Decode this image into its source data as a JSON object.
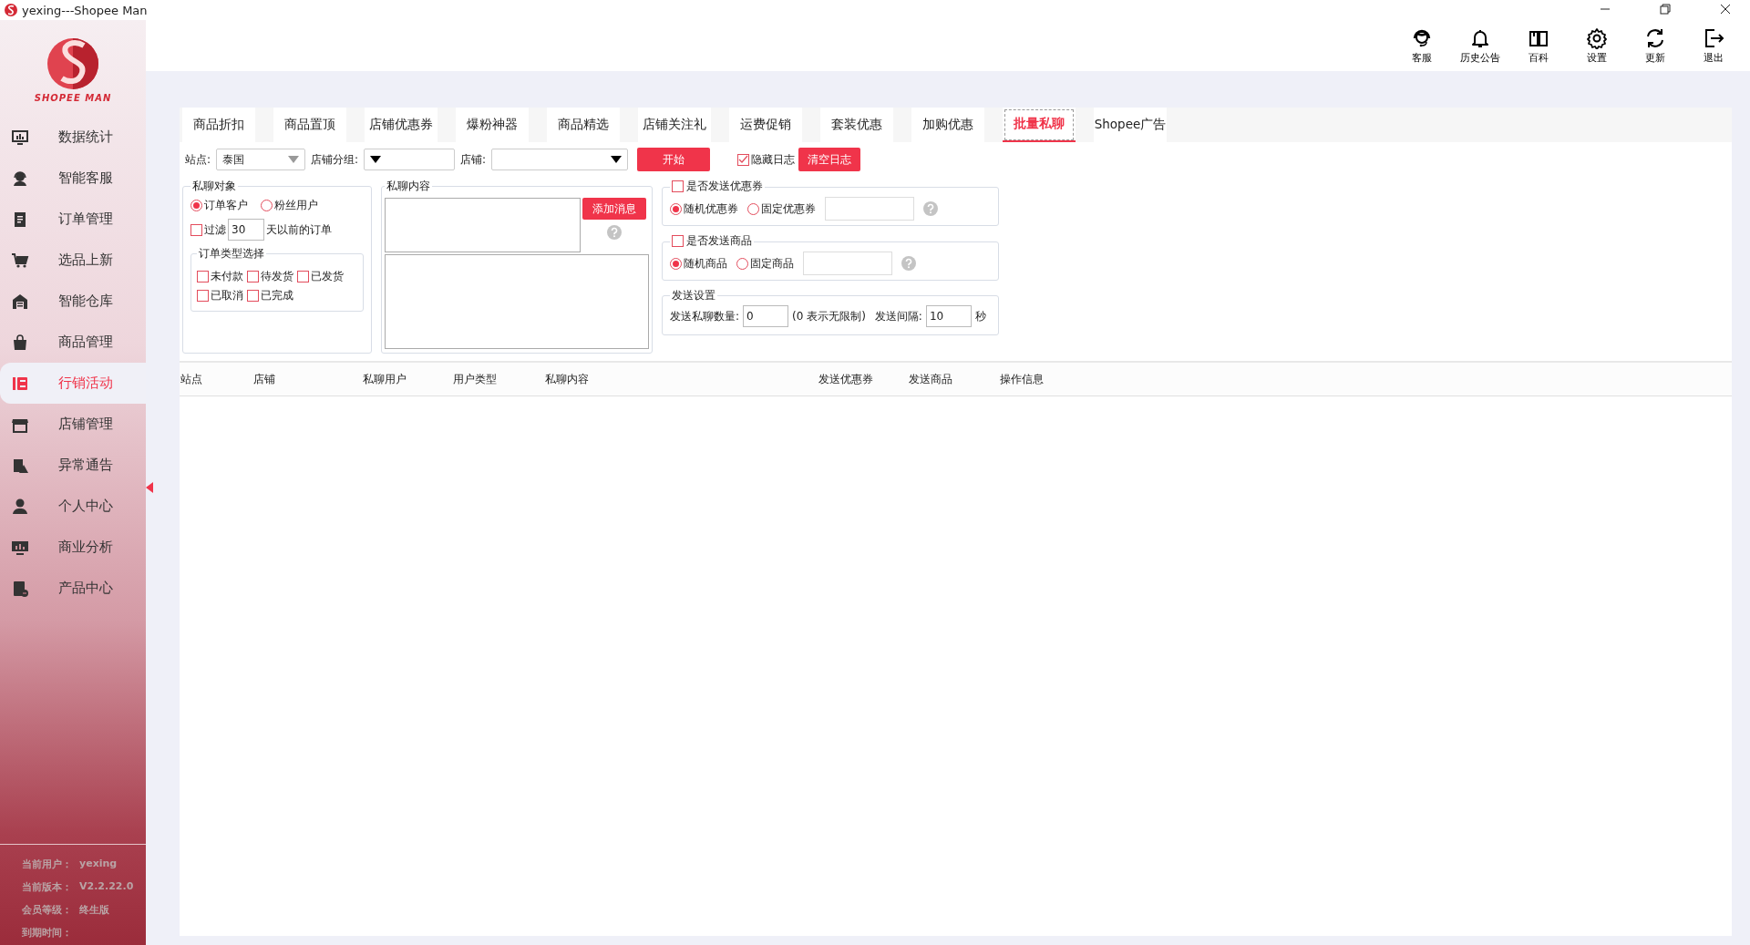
{
  "window": {
    "title": "yexing---Shopee Man"
  },
  "logo": {
    "text": "SHOPEE MAN"
  },
  "sidebar": {
    "items": [
      {
        "label": "数据统计",
        "selected": false
      },
      {
        "label": "智能客服",
        "selected": false
      },
      {
        "label": "订单管理",
        "selected": false
      },
      {
        "label": "选品上新",
        "selected": false
      },
      {
        "label": "智能仓库",
        "selected": false
      },
      {
        "label": "商品管理",
        "selected": false
      },
      {
        "label": "行销活动",
        "selected": true
      },
      {
        "label": "店铺管理",
        "selected": false
      },
      {
        "label": "异常通告",
        "selected": false
      },
      {
        "label": "个人中心",
        "selected": false
      },
      {
        "label": "商业分析",
        "selected": false
      },
      {
        "label": "产品中心",
        "selected": false
      }
    ]
  },
  "sidebar_info": [
    {
      "label": "当前用户：",
      "value": "yexing"
    },
    {
      "label": "当前版本：",
      "value": "V2.2.22.0"
    },
    {
      "label": "会员等级：",
      "value": "终生版"
    },
    {
      "label": "到期时间："
    }
  ],
  "toolbar": [
    {
      "label": "客服"
    },
    {
      "label": "历史公告"
    },
    {
      "label": "百科"
    },
    {
      "label": "设置"
    },
    {
      "label": "更新"
    },
    {
      "label": "退出"
    }
  ],
  "tabs": [
    {
      "label": "商品折扣",
      "selected": false
    },
    {
      "label": "商品置顶",
      "selected": false
    },
    {
      "label": "店铺优惠券",
      "selected": false
    },
    {
      "label": "爆粉神器",
      "selected": false
    },
    {
      "label": "商品精选",
      "selected": false
    },
    {
      "label": "店铺关注礼",
      "selected": false
    },
    {
      "label": "运费促销",
      "selected": false
    },
    {
      "label": "套装优惠",
      "selected": false
    },
    {
      "label": "加购优惠",
      "selected": false
    },
    {
      "label": "批量私聊",
      "selected": true
    },
    {
      "label": "Shopee广告",
      "selected": false
    }
  ],
  "filters": {
    "site_label": "站点:",
    "site_value": "泰国",
    "group_label": "店铺分组:",
    "shop_label": "店铺:"
  },
  "start_button": "开始",
  "hide_log": {
    "label": "隐藏日志",
    "checked": true
  },
  "clear_log_button": "清空日志",
  "target_group": {
    "title": "私聊对象",
    "options": [
      {
        "label": "订单客户",
        "selected": true
      },
      {
        "label": "粉丝用户",
        "selected": false
      }
    ],
    "filter": {
      "label": "过滤",
      "checked": false,
      "value": "30",
      "suffix": "天以前的订单"
    },
    "order_types": {
      "title": "订单类型选择",
      "items": [
        {
          "label": "未付款",
          "checked": false
        },
        {
          "label": "待发货",
          "checked": false
        },
        {
          "label": "已发货",
          "checked": false
        },
        {
          "label": "已取消",
          "checked": false
        },
        {
          "label": "已完成",
          "checked": false
        }
      ]
    }
  },
  "content_group": {
    "title": "私聊内容",
    "add_button": "添加消息"
  },
  "coupon_group": {
    "title": "是否发送优惠券",
    "checked": false,
    "options": [
      {
        "label": "随机优惠券",
        "selected": true
      },
      {
        "label": "固定优惠券",
        "selected": false
      }
    ]
  },
  "product_group": {
    "title": "是否发送商品",
    "checked": false,
    "options": [
      {
        "label": "随机商品",
        "selected": true
      },
      {
        "label": "固定商品",
        "selected": false
      }
    ]
  },
  "send_settings": {
    "title": "发送设置",
    "count_label": "发送私聊数量:",
    "count_value": "0",
    "count_hint": "(0 表示无限制)",
    "interval_label": "发送间隔:",
    "interval_value": "10",
    "interval_unit": "秒"
  },
  "table": {
    "columns": [
      "站点",
      "店铺",
      "私聊用户",
      "用户类型",
      "私聊内容",
      "发送优惠券",
      "发送商品",
      "操作信息"
    ]
  }
}
